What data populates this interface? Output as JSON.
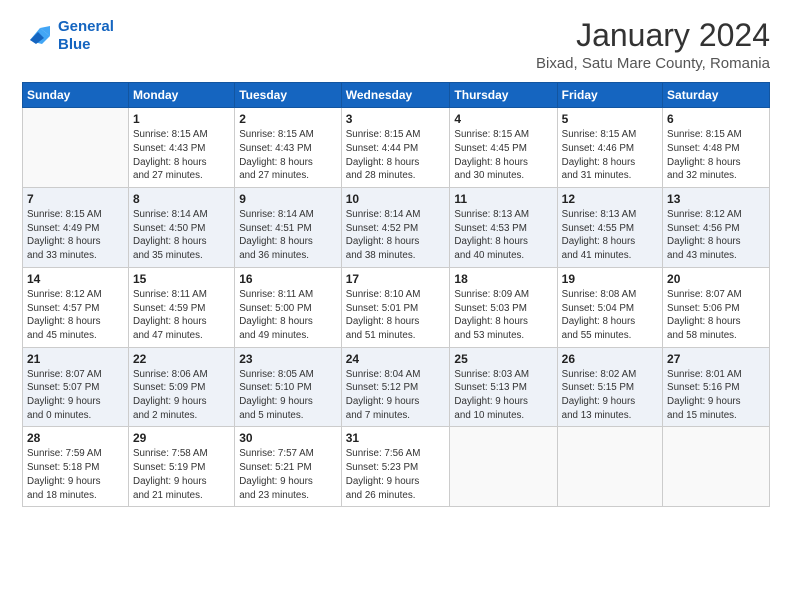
{
  "header": {
    "logo_line1": "General",
    "logo_line2": "Blue",
    "main_title": "January 2024",
    "subtitle": "Bixad, Satu Mare County, Romania"
  },
  "weekdays": [
    "Sunday",
    "Monday",
    "Tuesday",
    "Wednesday",
    "Thursday",
    "Friday",
    "Saturday"
  ],
  "weeks": [
    [
      {
        "day": "",
        "info": ""
      },
      {
        "day": "1",
        "info": "Sunrise: 8:15 AM\nSunset: 4:43 PM\nDaylight: 8 hours\nand 27 minutes."
      },
      {
        "day": "2",
        "info": "Sunrise: 8:15 AM\nSunset: 4:43 PM\nDaylight: 8 hours\nand 27 minutes."
      },
      {
        "day": "3",
        "info": "Sunrise: 8:15 AM\nSunset: 4:44 PM\nDaylight: 8 hours\nand 28 minutes."
      },
      {
        "day": "4",
        "info": "Sunrise: 8:15 AM\nSunset: 4:45 PM\nDaylight: 8 hours\nand 30 minutes."
      },
      {
        "day": "5",
        "info": "Sunrise: 8:15 AM\nSunset: 4:46 PM\nDaylight: 8 hours\nand 31 minutes."
      },
      {
        "day": "6",
        "info": "Sunrise: 8:15 AM\nSunset: 4:48 PM\nDaylight: 8 hours\nand 32 minutes."
      }
    ],
    [
      {
        "day": "7",
        "info": ""
      },
      {
        "day": "8",
        "info": "Sunrise: 8:14 AM\nSunset: 4:50 PM\nDaylight: 8 hours\nand 35 minutes."
      },
      {
        "day": "9",
        "info": "Sunrise: 8:14 AM\nSunset: 4:51 PM\nDaylight: 8 hours\nand 36 minutes."
      },
      {
        "day": "10",
        "info": "Sunrise: 8:14 AM\nSunset: 4:52 PM\nDaylight: 8 hours\nand 38 minutes."
      },
      {
        "day": "11",
        "info": "Sunrise: 8:13 AM\nSunset: 4:53 PM\nDaylight: 8 hours\nand 40 minutes."
      },
      {
        "day": "12",
        "info": "Sunrise: 8:13 AM\nSunset: 4:55 PM\nDaylight: 8 hours\nand 41 minutes."
      },
      {
        "day": "13",
        "info": "Sunrise: 8:12 AM\nSunset: 4:56 PM\nDaylight: 8 hours\nand 43 minutes."
      }
    ],
    [
      {
        "day": "14",
        "info": ""
      },
      {
        "day": "15",
        "info": "Sunrise: 8:11 AM\nSunset: 4:59 PM\nDaylight: 8 hours\nand 47 minutes."
      },
      {
        "day": "16",
        "info": "Sunrise: 8:11 AM\nSunset: 5:00 PM\nDaylight: 8 hours\nand 49 minutes."
      },
      {
        "day": "17",
        "info": "Sunrise: 8:10 AM\nSunset: 5:01 PM\nDaylight: 8 hours\nand 51 minutes."
      },
      {
        "day": "18",
        "info": "Sunrise: 8:09 AM\nSunset: 5:03 PM\nDaylight: 8 hours\nand 53 minutes."
      },
      {
        "day": "19",
        "info": "Sunrise: 8:08 AM\nSunset: 5:04 PM\nDaylight: 8 hours\nand 55 minutes."
      },
      {
        "day": "20",
        "info": "Sunrise: 8:07 AM\nSunset: 5:06 PM\nDaylight: 8 hours\nand 58 minutes."
      }
    ],
    [
      {
        "day": "21",
        "info": ""
      },
      {
        "day": "22",
        "info": "Sunrise: 8:06 AM\nSunset: 5:09 PM\nDaylight: 9 hours\nand 2 minutes."
      },
      {
        "day": "23",
        "info": "Sunrise: 8:05 AM\nSunset: 5:10 PM\nDaylight: 9 hours\nand 5 minutes."
      },
      {
        "day": "24",
        "info": "Sunrise: 8:04 AM\nSunset: 5:12 PM\nDaylight: 9 hours\nand 7 minutes."
      },
      {
        "day": "25",
        "info": "Sunrise: 8:03 AM\nSunset: 5:13 PM\nDaylight: 9 hours\nand 10 minutes."
      },
      {
        "day": "26",
        "info": "Sunrise: 8:02 AM\nSunset: 5:15 PM\nDaylight: 9 hours\nand 13 minutes."
      },
      {
        "day": "27",
        "info": "Sunrise: 8:01 AM\nSunset: 5:16 PM\nDaylight: 9 hours\nand 15 minutes."
      }
    ],
    [
      {
        "day": "28",
        "info": "Sunrise: 7:59 AM\nSunset: 5:18 PM\nDaylight: 9 hours\nand 18 minutes."
      },
      {
        "day": "29",
        "info": "Sunrise: 7:58 AM\nSunset: 5:19 PM\nDaylight: 9 hours\nand 21 minutes."
      },
      {
        "day": "30",
        "info": "Sunrise: 7:57 AM\nSunset: 5:21 PM\nDaylight: 9 hours\nand 23 minutes."
      },
      {
        "day": "31",
        "info": "Sunrise: 7:56 AM\nSunset: 5:23 PM\nDaylight: 9 hours\nand 26 minutes."
      },
      {
        "day": "",
        "info": ""
      },
      {
        "day": "",
        "info": ""
      },
      {
        "day": "",
        "info": ""
      }
    ]
  ],
  "week1_sunday": "Sunrise: 8:15 AM\nSunset: 4:49 PM\nDaylight: 8 hours\nand 33 minutes.",
  "week2_sunday": "Sunrise: 8:12 AM\nSunset: 4:57 PM\nDaylight: 8 hours\nand 45 minutes.",
  "week3_sunday": "Sunrise: 8:07 AM\nSunset: 5:07 PM\nDaylight: 9 hours\nand 0 minutes.",
  "week4_sunday": "Sunrise: 8:07 AM\nSunset: 5:07 PM\nDaylight: 9 hours\nand 0 minutes."
}
